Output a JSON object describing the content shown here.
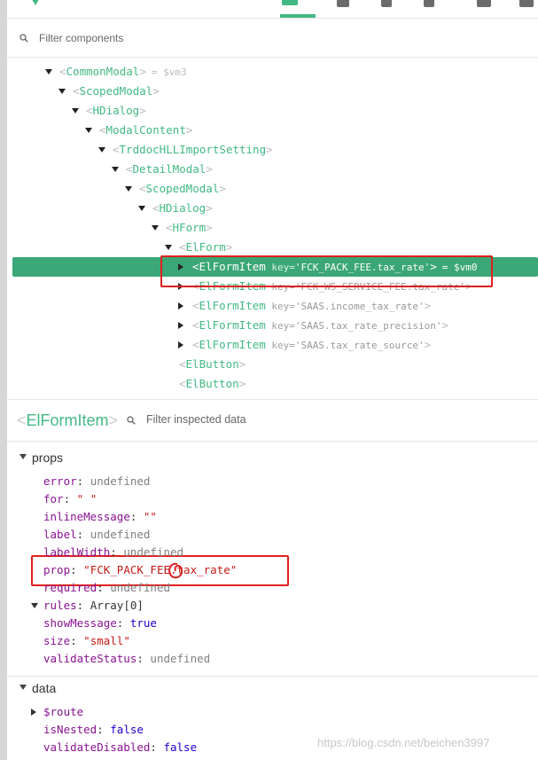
{
  "search": {
    "placeholder": "Filter components"
  },
  "tree": [
    {
      "name": "CommonModal",
      "vm": "= $vm3",
      "key": null,
      "arrow": "down",
      "indent": 0
    },
    {
      "name": "ScopedModal",
      "vm": "",
      "key": null,
      "arrow": "down",
      "indent": 1
    },
    {
      "name": "HDialog",
      "vm": "",
      "key": null,
      "arrow": "down",
      "indent": 2
    },
    {
      "name": "ModalContent",
      "vm": "",
      "key": null,
      "arrow": "down",
      "indent": 3
    },
    {
      "name": "TrddocHLLImportSetting",
      "vm": "",
      "key": null,
      "arrow": "down",
      "indent": 4
    },
    {
      "name": "DetailModal",
      "vm": "",
      "key": null,
      "arrow": "down",
      "indent": 5
    },
    {
      "name": "ScopedModal",
      "vm": "",
      "key": null,
      "arrow": "down",
      "indent": 6
    },
    {
      "name": "HDialog",
      "vm": "",
      "key": null,
      "arrow": "down",
      "indent": 7
    },
    {
      "name": "HForm",
      "vm": "",
      "key": null,
      "arrow": "down",
      "indent": 8
    },
    {
      "name": "ElForm",
      "vm": "",
      "key": null,
      "arrow": "down",
      "indent": 9
    },
    {
      "name": "ElFormItem",
      "vm": "= $vm0",
      "key": "FCK_PACK_FEE.tax_rate",
      "arrow": "right",
      "indent": 10,
      "selected": true
    },
    {
      "name": "ElFormItem",
      "vm": "",
      "key": "FCK_WS_SERVICE_FEE.tax_rate",
      "arrow": "right",
      "indent": 10
    },
    {
      "name": "ElFormItem",
      "vm": "",
      "key": "SAAS.income_tax_rate",
      "arrow": "right",
      "indent": 10
    },
    {
      "name": "ElFormItem",
      "vm": "",
      "key": "SAAS.tax_rate_precision",
      "arrow": "right",
      "indent": 10
    },
    {
      "name": "ElFormItem",
      "vm": "",
      "key": "SAAS.tax_rate_source",
      "arrow": "right",
      "indent": 10
    },
    {
      "name": "ElButton",
      "vm": "",
      "key": null,
      "arrow": "none",
      "indent": 9
    },
    {
      "name": "ElButton",
      "vm": "",
      "key": null,
      "arrow": "none",
      "indent": 9
    }
  ],
  "inspector": {
    "component": "ElFormItem",
    "filter_placeholder": "Filter inspected data",
    "props_label": "props",
    "data_label": "data"
  },
  "props": [
    {
      "k": "error",
      "v": "undefined",
      "t": "undef"
    },
    {
      "k": "for",
      "v": "\" \"",
      "t": "str"
    },
    {
      "k": "inlineMessage",
      "v": "\"\"",
      "t": "str"
    },
    {
      "k": "label",
      "v": "undefined",
      "t": "undef"
    },
    {
      "k": "labelWidth",
      "v": "undefined",
      "t": "undef"
    },
    {
      "k": "prop",
      "v": "\"FCK_PACK_FEE.tax_rate\"",
      "t": "str"
    },
    {
      "k": "required",
      "v": "undefined",
      "t": "undef"
    },
    {
      "k": "rules",
      "v": "Array[0]",
      "t": "plain",
      "arrow": "down"
    },
    {
      "k": "showMessage",
      "v": "true",
      "t": "bool"
    },
    {
      "k": "size",
      "v": "\"small\"",
      "t": "str"
    },
    {
      "k": "validateStatus",
      "v": "undefined",
      "t": "undef"
    }
  ],
  "data_items": [
    {
      "k": "$route",
      "v": "",
      "t": "plain",
      "arrow": "right"
    },
    {
      "k": "isNested",
      "v": "false",
      "t": "bool"
    },
    {
      "k": "validateDisabled",
      "v": "false",
      "t": "bool"
    }
  ],
  "watermark": "https://blog.csdn.net/beichen3997",
  "colors": {
    "accent": "#42b983",
    "selected": "#3ba776",
    "annotation": "#e02020"
  }
}
